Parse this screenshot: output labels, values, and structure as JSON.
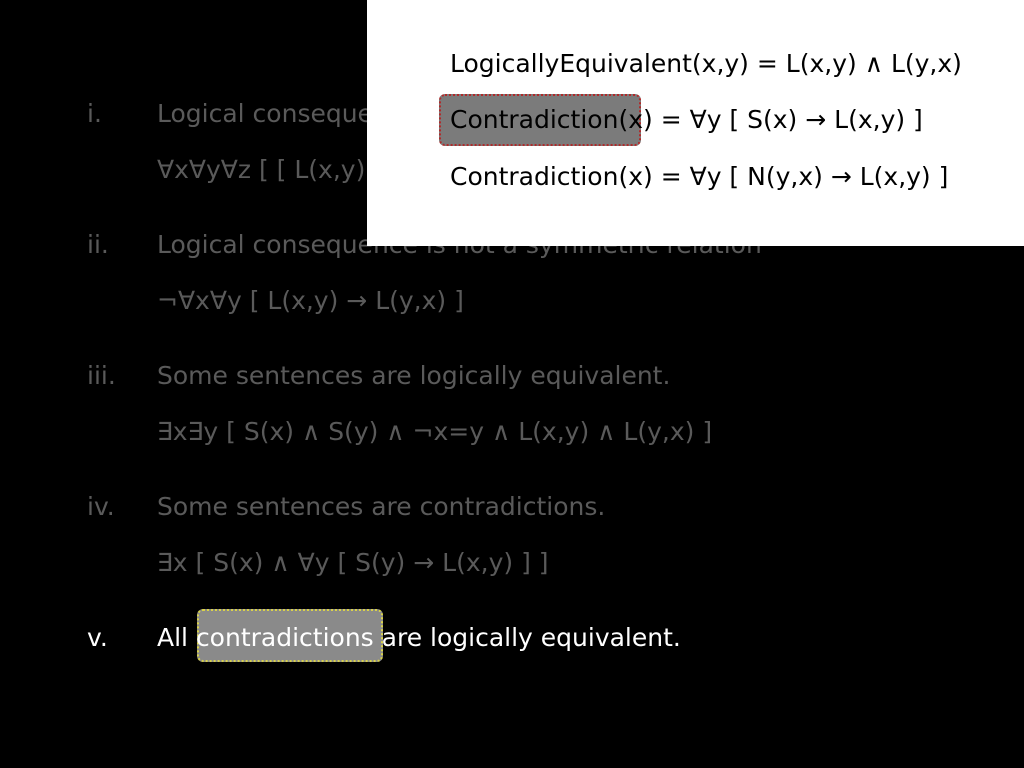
{
  "items": [
    {
      "num": "i.",
      "text": "Logical consequence is a transitive relation",
      "formula": "∀x∀y∀z [ [ L(x,y) ∧ L(y,z) ] → L(x,z) ]"
    },
    {
      "num": "ii.",
      "text": "Logical consequence is not a symmetric relation",
      "formula": "¬∀x∀y [ L(x,y) → L(y,x) ]"
    },
    {
      "num": "iii.",
      "text": "Some sentences are logically equivalent.",
      "formula": "∃x∃y [ S(x) ∧ S(y) ∧ ¬x=y ∧ L(x,y) ∧ L(y,x) ]"
    },
    {
      "num": "iv.",
      "text": "Some sentences are contradictions.",
      "formula": "∃x [ S(x) ∧ ∀y [ S(y) → L(x,y) ] ]"
    },
    {
      "num": "v.",
      "text": "All contradictions are logically equivalent."
    }
  ],
  "definitions": [
    "LogicallyEquivalent(x,y) = L(x,y) ∧ L(y,x)",
    "Contradiction(x) = ∀y [ S(x) → L(x,y) ]",
    "Contradiction(x) = ∀y [ N(y,x) → L(x,y) ]"
  ],
  "colors": {
    "background": "#000000",
    "dim_text": "#5a5a5a",
    "active_text": "#ffffff",
    "popup": "#ffffff",
    "highlight_red_border": "#b02a2a",
    "highlight_yellow_border": "#d9d24a"
  }
}
